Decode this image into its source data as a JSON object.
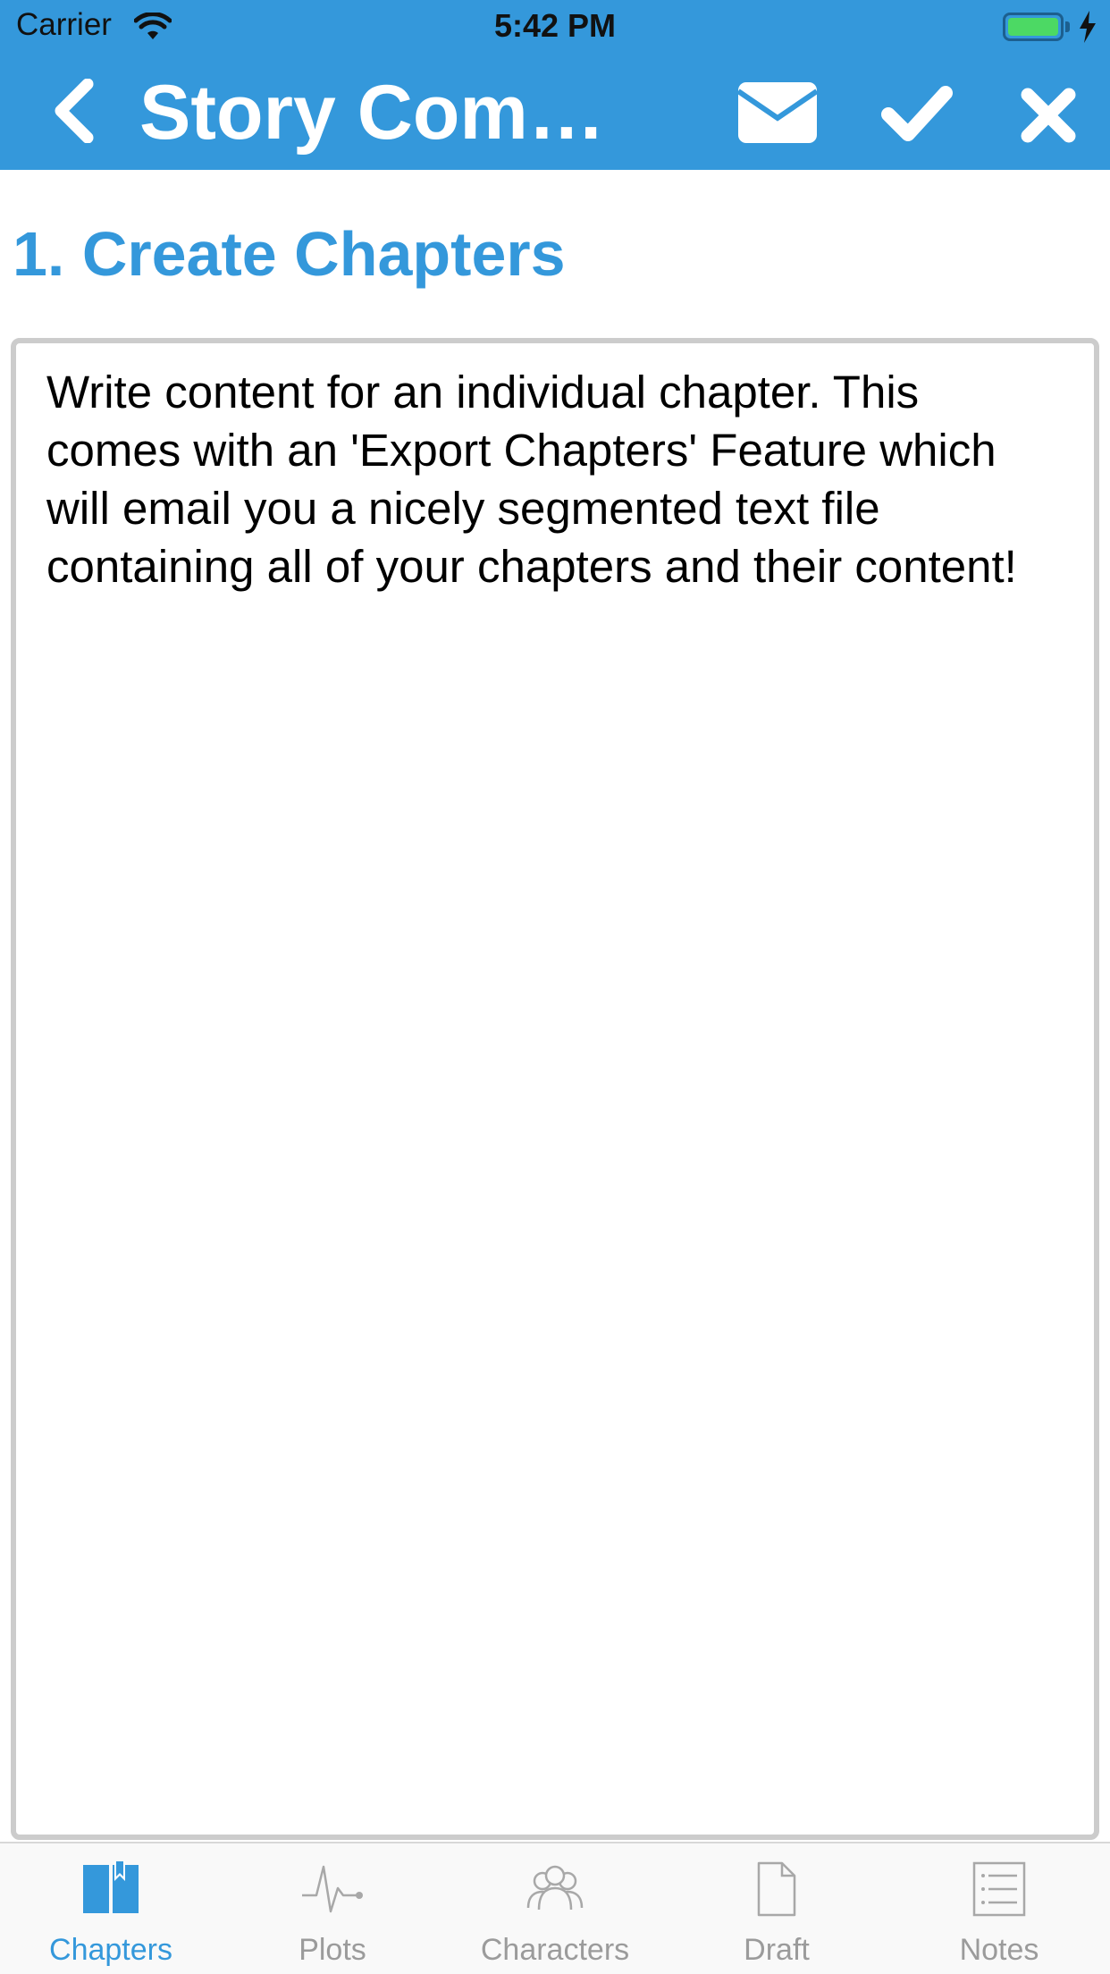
{
  "status_bar": {
    "carrier": "Carrier",
    "time": "5:42 PM"
  },
  "nav": {
    "title": "Story Comp...",
    "icons": [
      "back-icon",
      "mail-icon",
      "check-icon",
      "close-icon"
    ]
  },
  "section": {
    "title": "1. Create Chapters"
  },
  "editor": {
    "content": "Write content for an individual chapter. This comes with an 'Export Chapters' Feature which will email you a nicely segmented text file containing all of your chapters and their content!"
  },
  "tabs": [
    {
      "label": "Chapters",
      "icon": "book-icon",
      "active": true
    },
    {
      "label": "Plots",
      "icon": "heartbeat-icon",
      "active": false
    },
    {
      "label": "Characters",
      "icon": "people-icon",
      "active": false
    },
    {
      "label": "Draft",
      "icon": "document-icon",
      "active": false
    },
    {
      "label": "Notes",
      "icon": "list-icon",
      "active": false
    }
  ],
  "colors": {
    "brand": "#3498DB",
    "tab_inactive": "#9b9b9b",
    "battery": "#4cd964"
  }
}
